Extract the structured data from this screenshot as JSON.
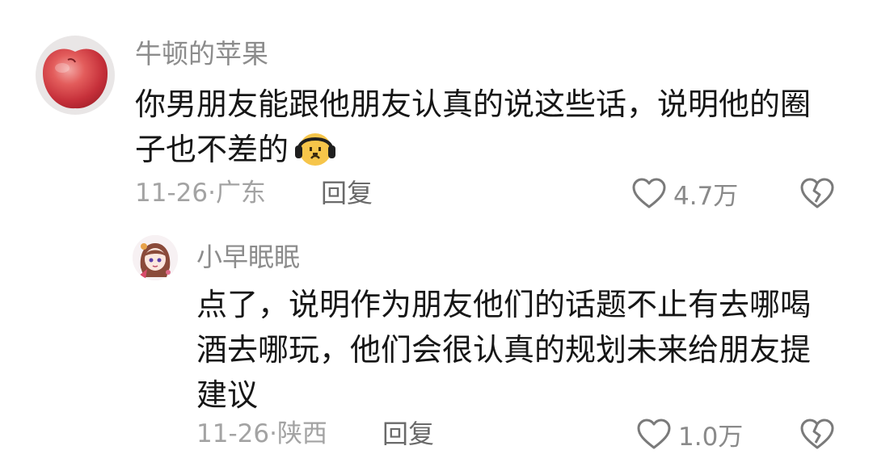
{
  "comments": [
    {
      "username": "牛顿的苹果",
      "avatar_icon": "apple-avatar",
      "text": "你男朋友能跟他朋友认真的说这些话，说明他的圈子也不差的",
      "emoji": "headphones-face-emoji",
      "date": "11-26·",
      "location": "广东",
      "reply_label": "回复",
      "likes": "4.7万",
      "like_icon": "heart-outline-icon",
      "dislike_icon": "broken-heart-icon"
    },
    {
      "username": "小早眠眠",
      "avatar_icon": "anime-girl-avatar",
      "text": "点了，说明作为朋友他们的话题不止有去哪喝酒去哪玩，他们会很认真的规划未来给朋友提建议",
      "date": "11-26·",
      "location": "陕西",
      "reply_label": "回复",
      "likes": "1.0万",
      "like_icon": "heart-outline-icon",
      "dislike_icon": "broken-heart-icon"
    }
  ],
  "colors": {
    "username": "#8c8c8c",
    "body_text": "#161616",
    "meta_text": "#a3a3a3",
    "reply_text": "#6a6a6a",
    "icon_stroke": "#7a7a7a"
  }
}
